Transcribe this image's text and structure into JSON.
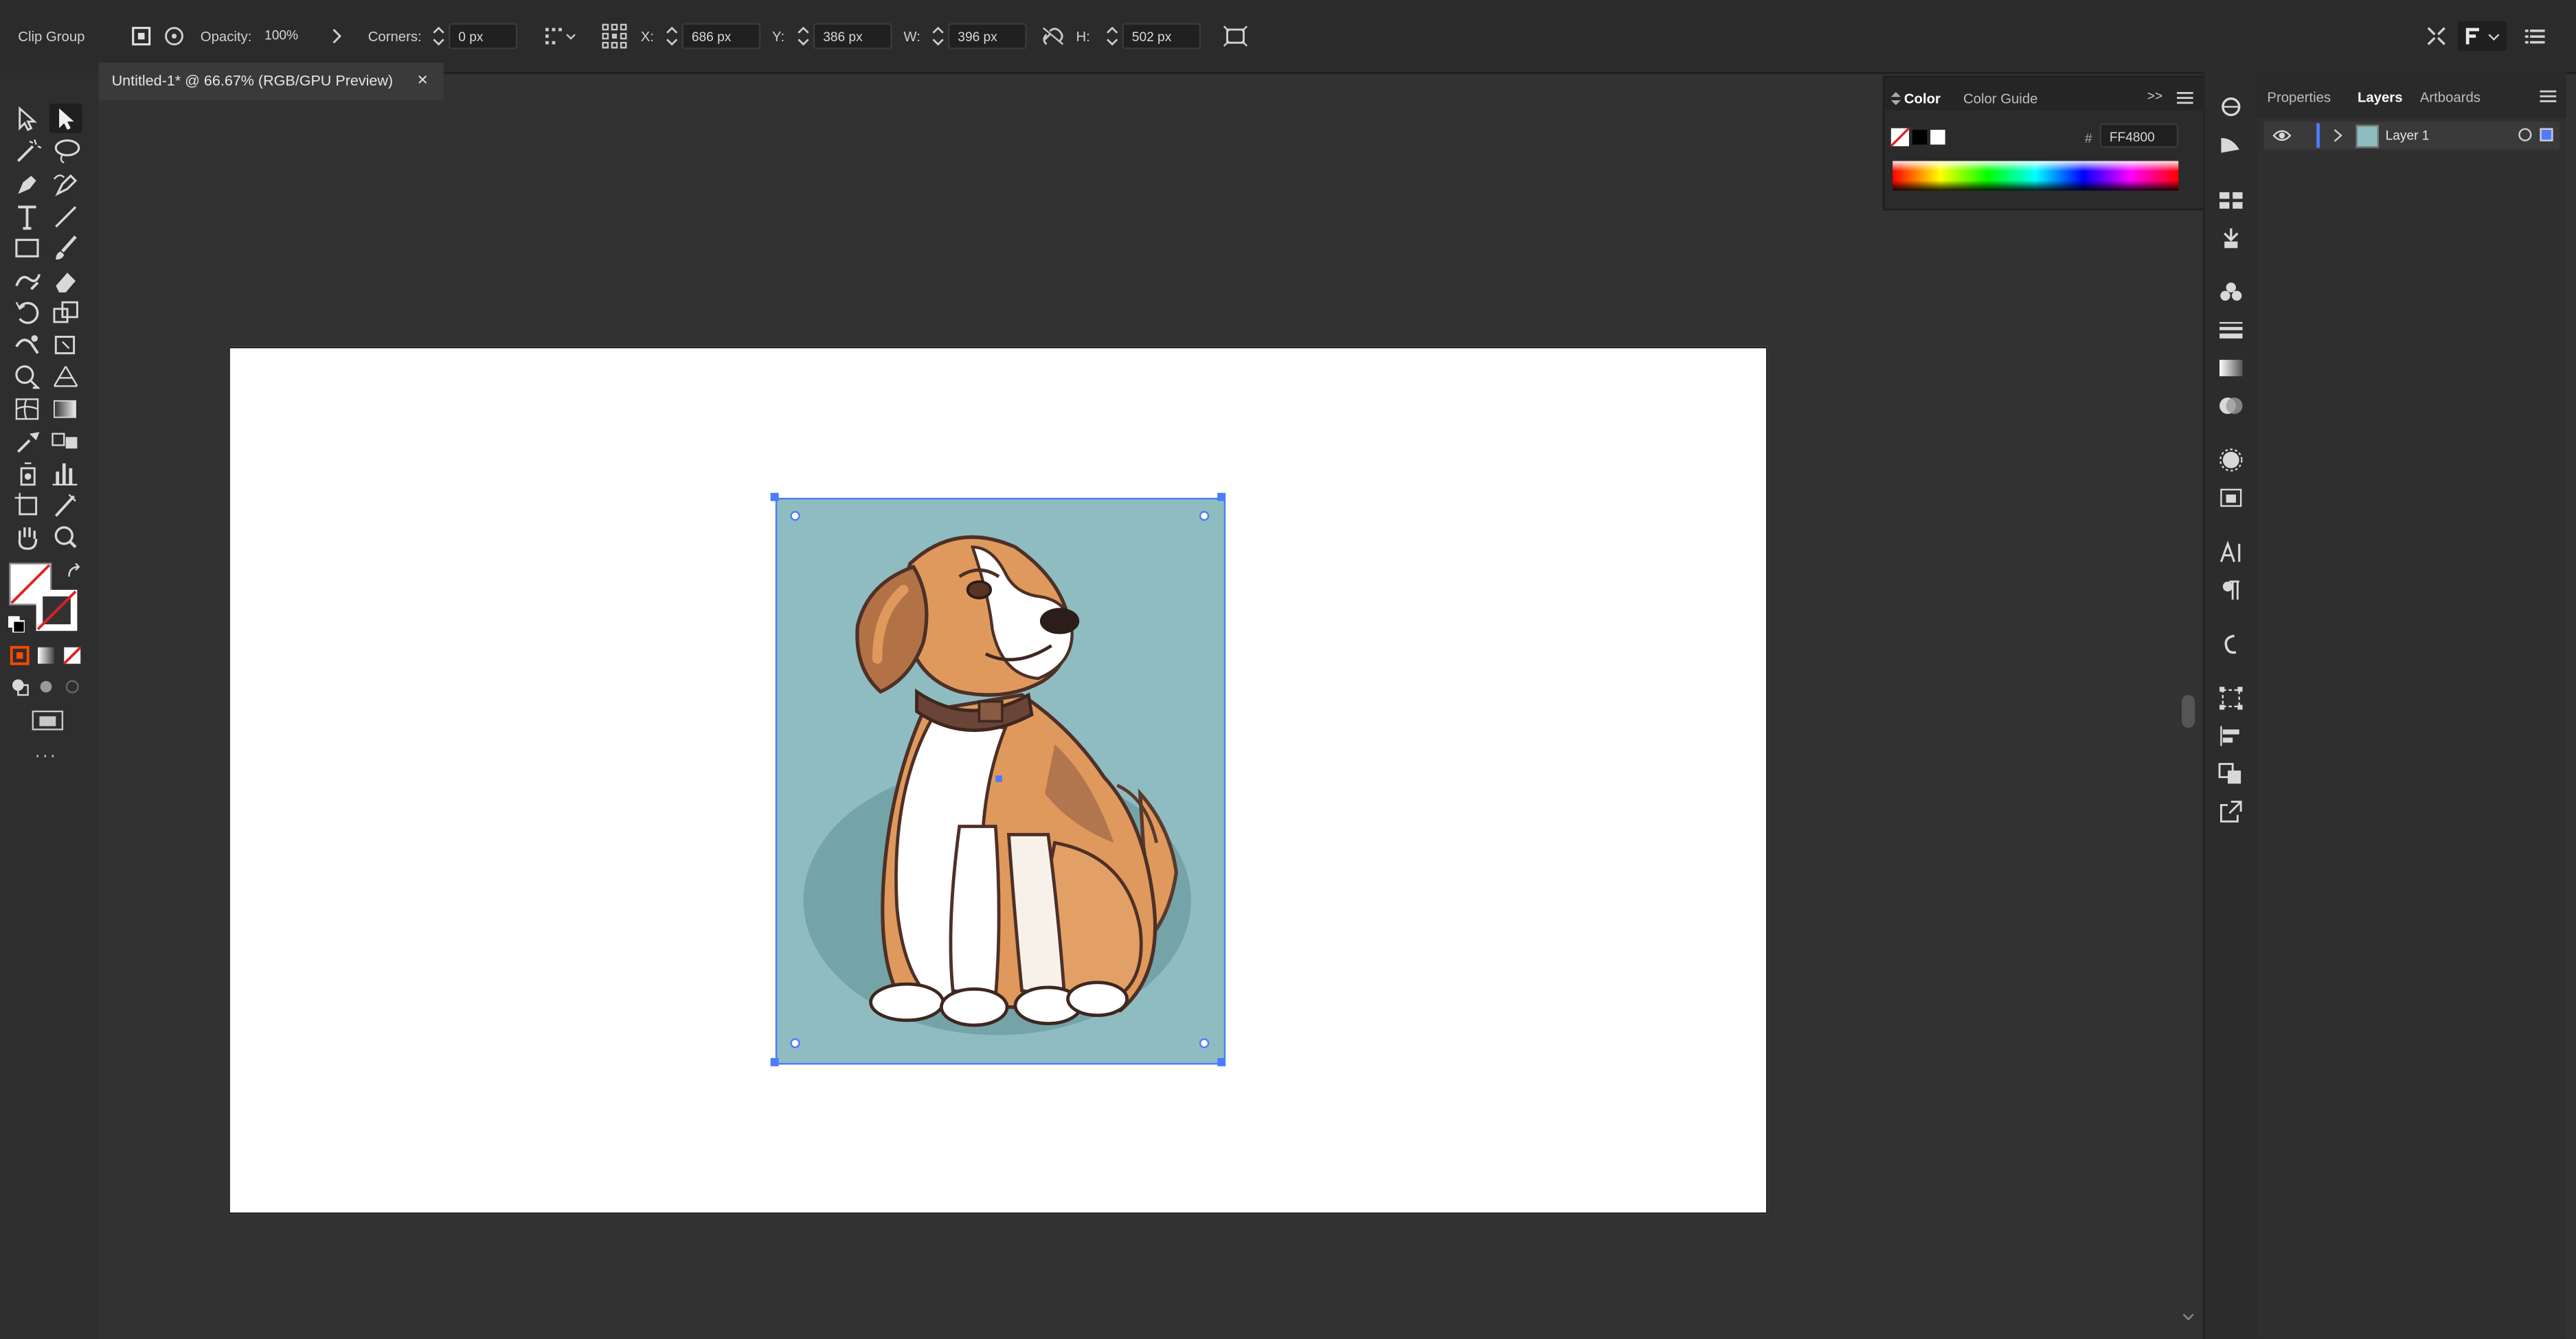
{
  "control_bar": {
    "selection_type": "Clip Group",
    "opacity_label": "Opacity:",
    "opacity_value": "100%",
    "corners_label": "Corners:",
    "corners_value": "0 px",
    "x_label": "X:",
    "x_value": "686 px",
    "y_label": "Y:",
    "y_value": "386 px",
    "w_label": "W:",
    "w_value": "396 px",
    "h_label": "H:",
    "h_value": "502 px"
  },
  "document": {
    "tab_title": "Untitled-1* @ 66.67% (RGB/GPU Preview)",
    "close_glyph": "×"
  },
  "color_panel": {
    "tabs": [
      "Color",
      "Color Guide"
    ],
    "hex_prefix": "#",
    "hex_value": "FF4800",
    "more_glyph": ">>"
  },
  "right_panel": {
    "tabs": [
      "Properties",
      "Layers",
      "Artboards"
    ],
    "active_tab": "Layers",
    "layers": [
      {
        "name": "Layer 1",
        "color": "#4f7bff"
      }
    ]
  },
  "toolbar": {
    "more_glyph": "···"
  },
  "colors": {
    "selection": "#4a7cff",
    "illustration_bg": "#8fbcc0",
    "shadow": "#6e9ea2",
    "fur_orange": "#e0995c",
    "fur_brown": "#8a5a45",
    "collar": "#6b4438",
    "accent_orange": "#ff4800"
  },
  "icons": [
    "artboard-icon",
    "recolor-icon",
    "arrange-icon",
    "link-icon",
    "transform-icon",
    "more-icon"
  ]
}
